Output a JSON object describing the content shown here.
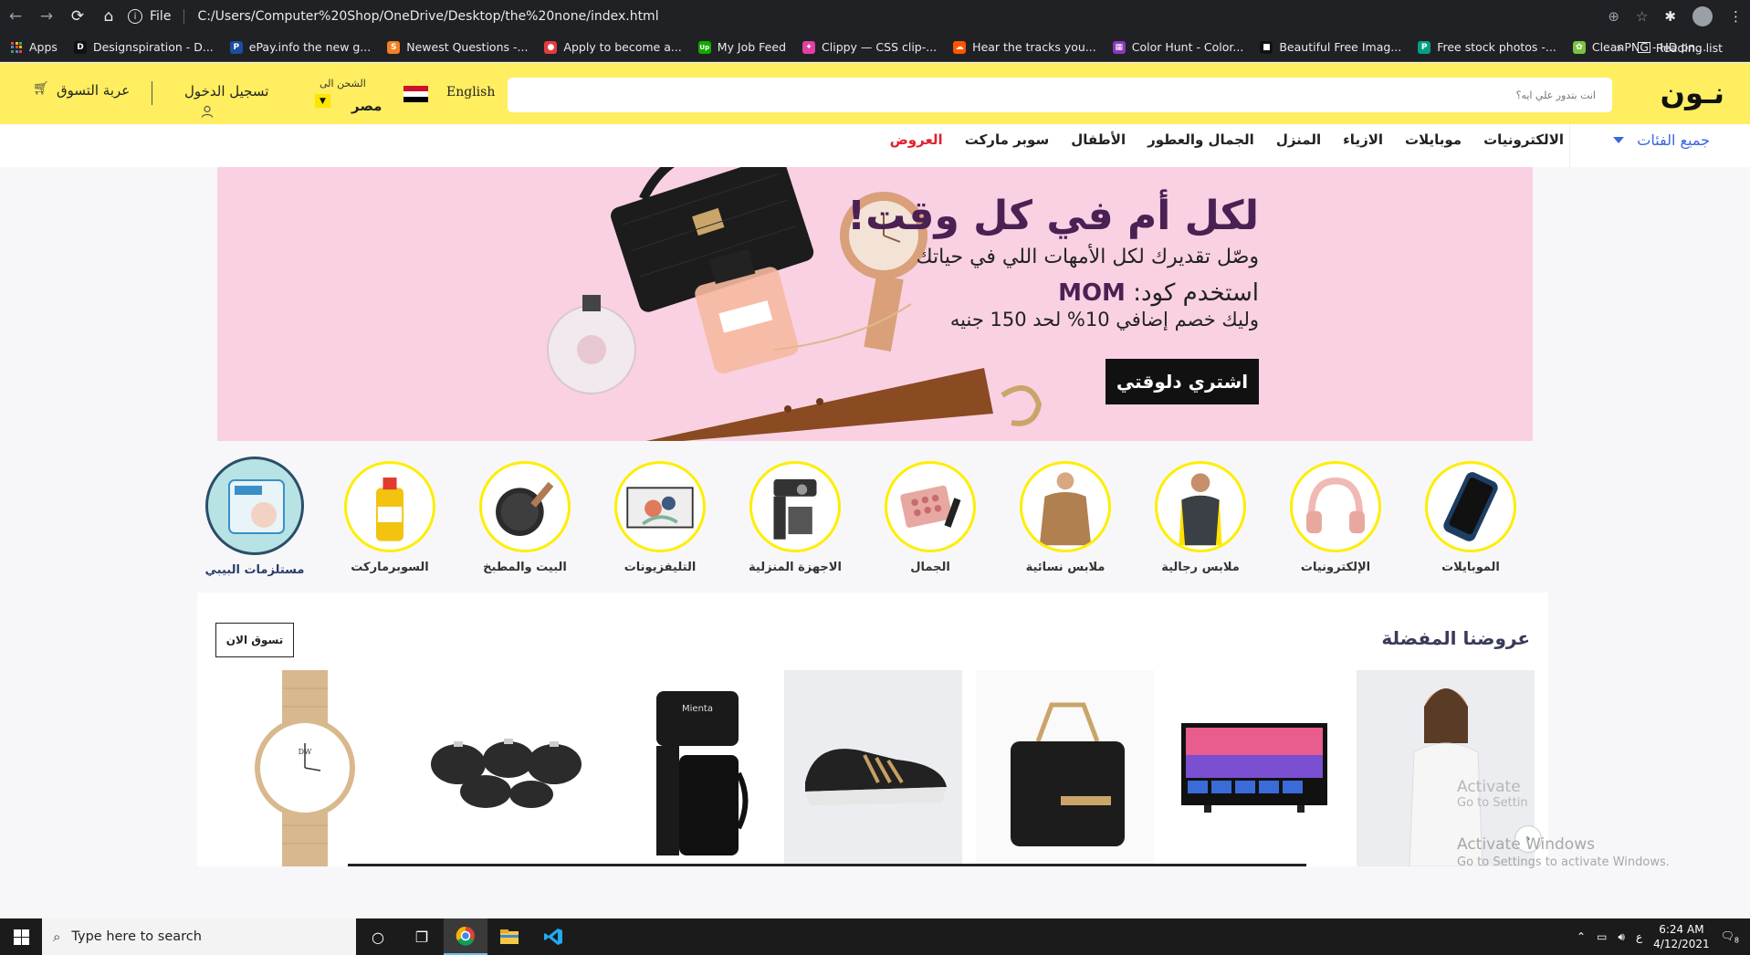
{
  "browser": {
    "file_label": "File",
    "url": "C:/Users/Computer%20Shop/OneDrive/Desktop/the%20none/index.html",
    "bookmarks": [
      {
        "label": "Apps",
        "color": "#ea4335",
        "glyph": ""
      },
      {
        "label": "Designspiration - D...",
        "color": "#111111",
        "glyph": "D"
      },
      {
        "label": "ePay.info the new g...",
        "color": "#1a4fa0",
        "glyph": "P"
      },
      {
        "label": "Newest Questions -...",
        "color": "#f48024",
        "glyph": "S"
      },
      {
        "label": "Apply to become a...",
        "color": "#e33c3c",
        "glyph": "●"
      },
      {
        "label": "My Job Feed",
        "color": "#14a800",
        "glyph": "Up"
      },
      {
        "label": "Clippy — CSS clip-...",
        "color": "#e040a0",
        "glyph": "✦"
      },
      {
        "label": "Hear the tracks you...",
        "color": "#ff5500",
        "glyph": "☁"
      },
      {
        "label": "Color Hunt - Color...",
        "color": "#8a3ab9",
        "glyph": "▦"
      },
      {
        "label": "Beautiful Free Imag...",
        "color": "#111111",
        "glyph": "■"
      },
      {
        "label": "Free stock photos -...",
        "color": "#05a081",
        "glyph": "P"
      },
      {
        "label": "CleanPNG - HD pn...",
        "color": "#7dc242",
        "glyph": "✿"
      }
    ],
    "reading_list": "Reading list",
    "more_bookmarks": "»"
  },
  "header": {
    "logo": "نـون",
    "search_placeholder": "انت بتدور علي ايه؟",
    "language": "English",
    "ship_to_label": "الشحن الى",
    "ship_country": "مصر",
    "sign_in": "تسجيل الدخول",
    "cart": "عربة التسوق",
    "flag_colors": [
      "#ce1126",
      "#ffffff",
      "#000000"
    ]
  },
  "category_nav": {
    "all_categories": "جميع الفئات",
    "items": [
      "الالكترونيات",
      "موبايلات",
      "الازياء",
      "المنزل",
      "الجمال والعطور",
      "الأطفال",
      "سوبر ماركت",
      "العروض"
    ]
  },
  "banner": {
    "headline": "لكل أم في كل وقت!",
    "subline": "وصّل تقديرك لكل الأمهات اللي في حياتك",
    "code_prefix": "استخدم كود: ",
    "code": "MOM",
    "discount": "وليك خصم إضافي 10% لحد 150 جنيه",
    "cta": "اشتري دلوقتي",
    "background": "#f9d1e3"
  },
  "circles": [
    {
      "label": "الموبايلات",
      "icon": "phone"
    },
    {
      "label": "الإلكترونيات",
      "icon": "headphones"
    },
    {
      "label": "ملابس رجالية",
      "icon": "men"
    },
    {
      "label": "ملابس نسائية",
      "icon": "women"
    },
    {
      "label": "الجمال",
      "icon": "beauty"
    },
    {
      "label": "الاجهزة المنزلية",
      "icon": "coffee-machine"
    },
    {
      "label": "التليفزيونات",
      "icon": "tv"
    },
    {
      "label": "البيت والمطبخ",
      "icon": "pan"
    },
    {
      "label": "السوبرماركت",
      "icon": "oil"
    },
    {
      "label": "مستلزمات البيبي",
      "icon": "diapers"
    }
  ],
  "featured": {
    "title": "عروضنا المفضلة",
    "shop_now": "تسوق الان",
    "products": [
      "woman-shirt",
      "tv",
      "handbag",
      "sneaker",
      "coffee-maker",
      "cookware",
      "watch"
    ],
    "coffee_brand": "Mienta",
    "watch_brand": "DW"
  },
  "watermark": {
    "line1": "Activate",
    "line1_small": "Go to Settin",
    "line2": "Activate Windows",
    "line2_small": "Go to Settings to activate Windows."
  },
  "taskbar": {
    "search_placeholder": "Type here to search",
    "time": "6:24 AM",
    "date": "4/12/2021",
    "lang": "ع",
    "notif_count": "8"
  }
}
